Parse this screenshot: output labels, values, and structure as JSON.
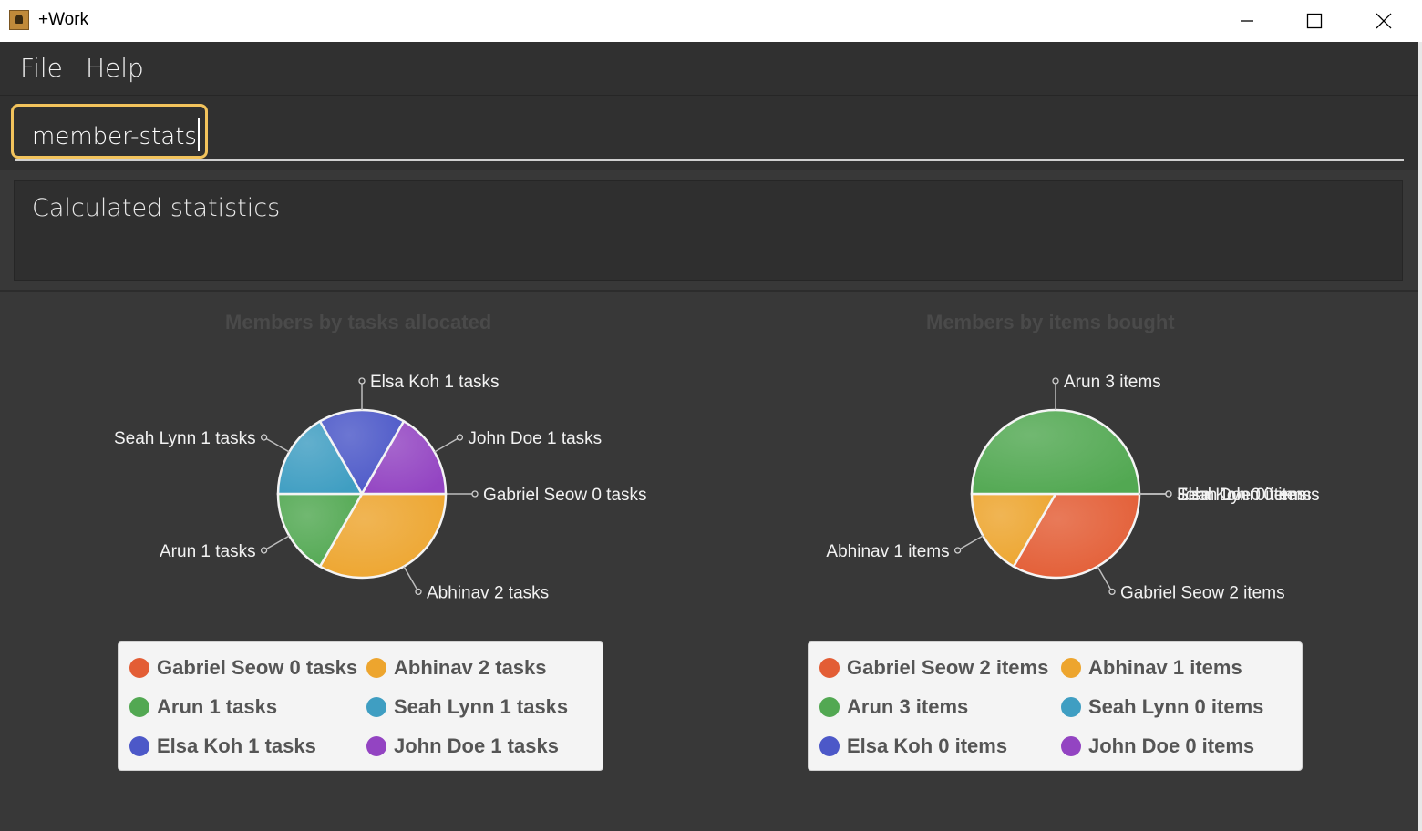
{
  "window": {
    "title": "+Work"
  },
  "menu": {
    "file": "File",
    "help": "Help"
  },
  "command": {
    "value": "member-stats"
  },
  "result": {
    "text": "Calculated statistics"
  },
  "colors": {
    "orange_red": "#e35d35",
    "amber": "#eda52e",
    "green": "#52a852",
    "teal": "#3f9ec2",
    "blue": "#4c58c8",
    "purple": "#9344c2"
  },
  "chart_data": [
    {
      "type": "pie",
      "title": "Members by tasks allocated",
      "slices": [
        {
          "label": "Gabriel Seow 0 tasks",
          "value": 0,
          "color": "#e35d35"
        },
        {
          "label": "Abhinav 2 tasks",
          "value": 2,
          "color": "#eda52e"
        },
        {
          "label": "Arun 1 tasks",
          "value": 1,
          "color": "#52a852"
        },
        {
          "label": "Seah Lynn 1 tasks",
          "value": 1,
          "color": "#3f9ec2"
        },
        {
          "label": "Elsa Koh 1 tasks",
          "value": 1,
          "color": "#4c58c8"
        },
        {
          "label": "John Doe 1 tasks",
          "value": 1,
          "color": "#9344c2"
        }
      ],
      "legend": "bottom"
    },
    {
      "type": "pie",
      "title": "Members by items bought",
      "slices": [
        {
          "label": "Gabriel Seow 2 items",
          "value": 2,
          "color": "#e35d35"
        },
        {
          "label": "Abhinav 1 items",
          "value": 1,
          "color": "#eda52e"
        },
        {
          "label": "Arun 3 items",
          "value": 3,
          "color": "#52a852"
        },
        {
          "label": "Seah Lynn 0 items",
          "value": 0,
          "color": "#3f9ec2"
        },
        {
          "label": "Elsa Koh 0 items",
          "value": 0,
          "color": "#4c58c8"
        },
        {
          "label": "John Doe 0 items",
          "value": 0,
          "color": "#9344c2"
        }
      ],
      "legend": "bottom"
    }
  ]
}
